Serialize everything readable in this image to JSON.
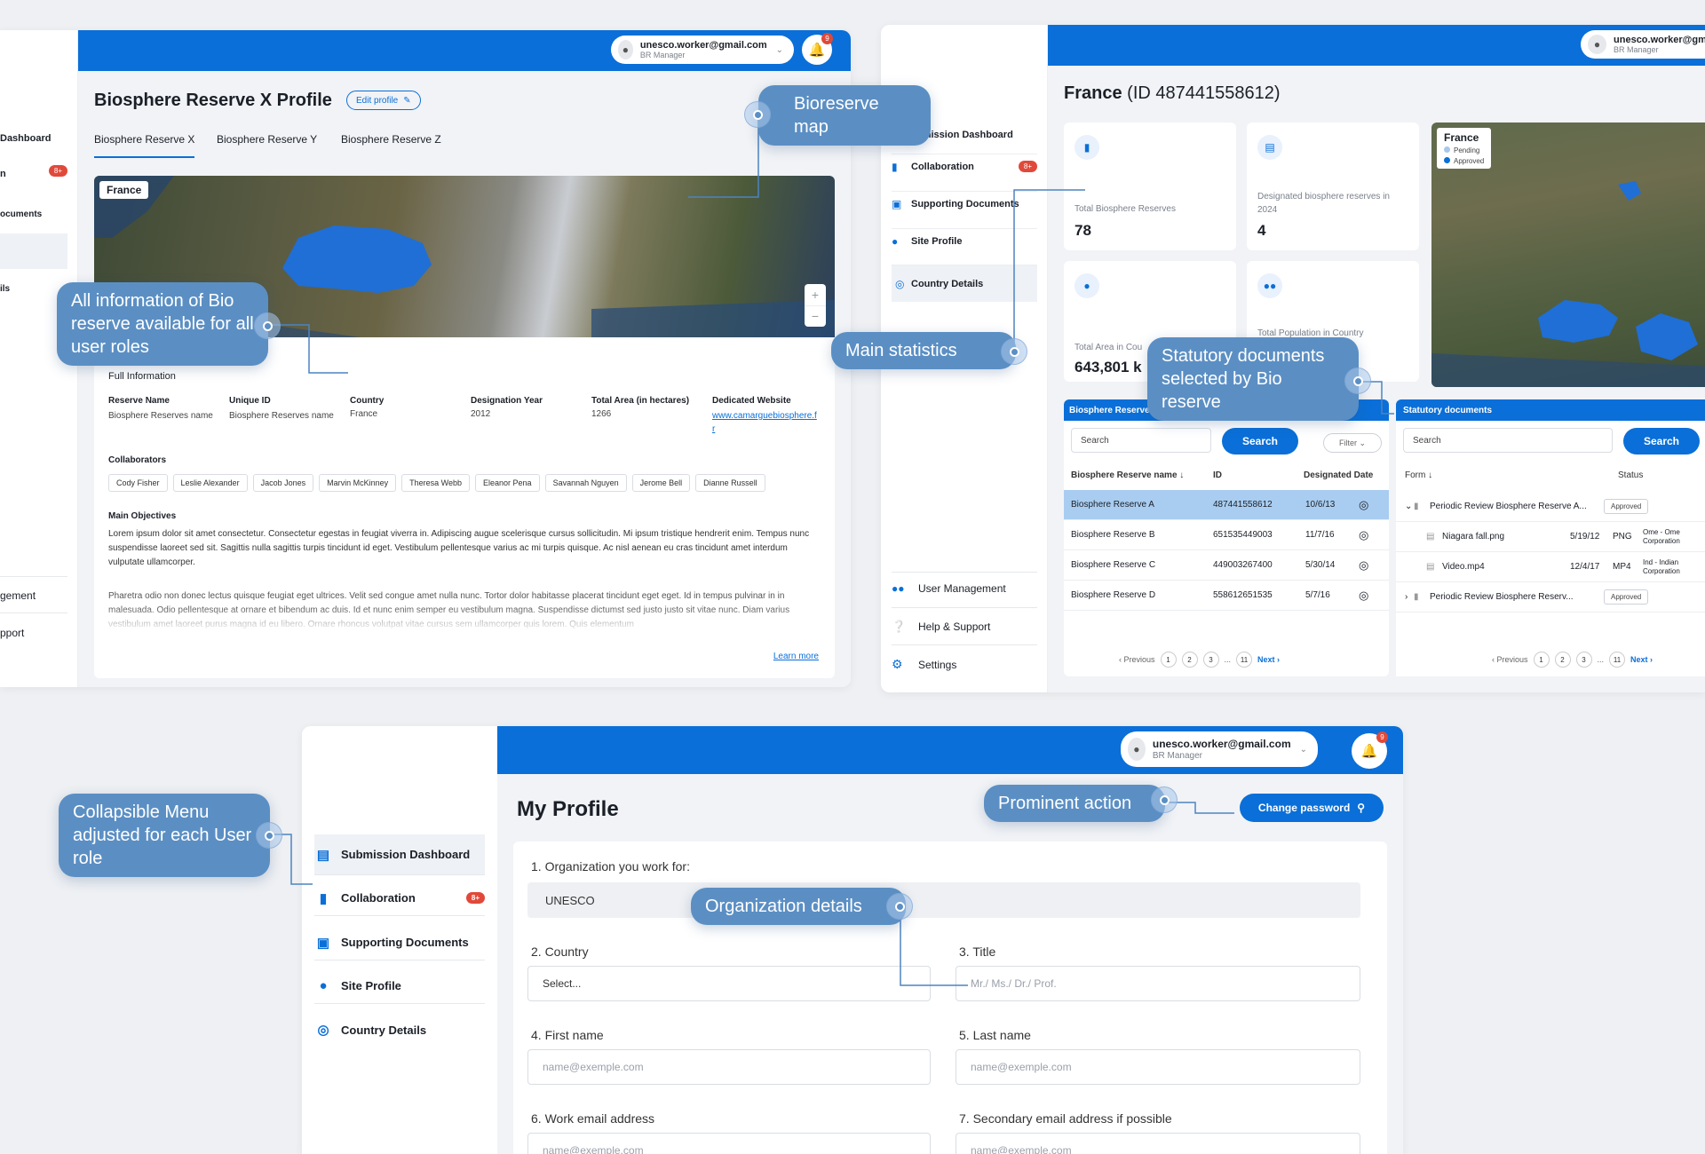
{
  "user": {
    "email": "unesco.worker@gmail.com",
    "email_trunc": "unesco.worker@gma",
    "role": "BR Manager",
    "notifications": "9"
  },
  "profile_panel": {
    "sidebar": {
      "dashboard": "Dashboard",
      "documents": "ocuments",
      "details": "ils",
      "badge": "8+",
      "management": "gement",
      "support": "pport"
    },
    "title": "Biosphere Reserve X Profile",
    "edit_button": "Edit profile",
    "tabs": [
      "Biosphere Reserve X",
      "Biosphere Reserve Y",
      "Biosphere Reserve Z"
    ],
    "map_label": "France",
    "section_title": "Full Information",
    "fields": [
      {
        "label": "Reserve Name",
        "value": "Biosphere Reserves name"
      },
      {
        "label": "Unique ID",
        "value": "Biosphere Reserves name"
      },
      {
        "label": "Country",
        "value": "France"
      },
      {
        "label": "Designation Year",
        "value": "2012"
      },
      {
        "label": "Total Area (in hectares)",
        "value": "1266"
      },
      {
        "label": "Dedicated Website",
        "value": "www.camarguebiosphere.fr"
      }
    ],
    "collaborators_title": "Collaborators",
    "collaborators": [
      "Cody Fisher",
      "Leslie Alexander",
      "Jacob Jones",
      "Marvin McKinney",
      "Theresa Webb",
      "Eleanor Pena",
      "Savannah Nguyen",
      "Jerome Bell",
      "Dianne Russell"
    ],
    "objectives_title": "Main Objectives",
    "objectives_p1": "Lorem ipsum dolor sit amet consectetur. Consectetur egestas in feugiat viverra in. Adipiscing augue scelerisque cursus sollicitudin. Mi ipsum tristique hendrerit enim. Tempus nunc suspendisse laoreet sed sit. Sagittis nulla sagittis turpis tincidunt id eget. Vestibulum pellentesque varius ac mi turpis quisque. Ac nisl aenean eu cras tincidunt amet interdum vulputate ullamcorper.",
    "objectives_p2": "Pharetra odio non donec lectus quisque feugiat eget ultrices. Velit sed congue amet nulla nunc. Tortor dolor habitasse placerat tincidunt eget eget. Id in tempus pulvinar in in malesuada. Odio pellentesque at ornare et bibendum ac duis. Id et nunc enim semper eu vestibulum magna. Suspendisse dictumst sed justo justo sit vitae nunc. Diam varius vestibulum amet laoreet purus magna id eu libero. Ornare rhoncus volutpat vitae cursus sem ullamcorper quis lorem. Quis elementum",
    "learn_more": "Learn more"
  },
  "country_panel": {
    "sidebar": [
      "omission Dashboard",
      "Collaboration",
      "Supporting Documents",
      "Site Profile",
      "Country Details",
      "User Management",
      "Help & Support",
      "Settings"
    ],
    "badge": "8+",
    "title": "France",
    "title_id": "(ID 487441558612)",
    "stats": [
      {
        "label": "Total Biosphere Reserves",
        "value": "78"
      },
      {
        "label": "Designated biosphere reserves in 2024",
        "value": "4"
      },
      {
        "label": "Total Area in Cou",
        "value": "643,801 k"
      },
      {
        "label": "Total Population in Country",
        "value": ""
      }
    ],
    "map_title": "France",
    "legend": [
      "Pending",
      "Approved"
    ],
    "reserves_header": "Biosphere Reserves",
    "search_placeholder": "Search",
    "search_button": "Search",
    "filter": "Filter",
    "columns": [
      "Biosphere Reserve name",
      "ID",
      "Designated Date"
    ],
    "rows": [
      {
        "name": "Biosphere Reserve A",
        "id": "487441558612",
        "date": "10/6/13"
      },
      {
        "name": "Biosphere Reserve B",
        "id": "651535449003",
        "date": "11/7/16"
      },
      {
        "name": "Biosphere Reserve C",
        "id": "449003267400",
        "date": "5/30/14"
      },
      {
        "name": "Biosphere Reserve D",
        "id": "558612651535",
        "date": "5/7/16"
      }
    ],
    "pager": {
      "prev": "Previous",
      "pages": [
        "1",
        "2",
        "3",
        "...",
        "11"
      ],
      "next": "Next"
    },
    "docs_header": "Statutory documents",
    "docs_columns": [
      "Form",
      "Status"
    ],
    "docs": [
      {
        "name": "Periodic Review Biosphere Reserve A...",
        "date": "",
        "type": "",
        "owner": "",
        "status": "Approved"
      },
      {
        "name": "Niagara fall.png",
        "date": "5/19/12",
        "type": "PNG",
        "owner": "Ome - Ome Corporation",
        "status": ""
      },
      {
        "name": "Video.mp4",
        "date": "12/4/17",
        "type": "MP4",
        "owner": "Ind - Indian Corporation",
        "status": ""
      },
      {
        "name": "Periodic Review Biosphere Reserv...",
        "date": "",
        "type": "",
        "owner": "",
        "status": "Approved"
      }
    ]
  },
  "my_profile_panel": {
    "menu": [
      "Submission Dashboard",
      "Collaboration",
      "Supporting Documents",
      "Site Profile",
      "Country Details"
    ],
    "badge": "8+",
    "title": "My Profile",
    "change_password": "Change password",
    "q1": "1. Organization you work for:",
    "q1_value": "UNESCO",
    "q2": "2. Country",
    "q2_value": "Select...",
    "q3": "3. Title",
    "q3_placeholder": "Mr./ Ms./ Dr./ Prof.",
    "q4": "4. First name",
    "q4_placeholder": "name@exemple.com",
    "q5": "5. Last name",
    "q5_placeholder": "name@exemple.com",
    "q6": "6. Work email address",
    "q6_placeholder": "name@exemple.com",
    "q7": "7. Secondary email address if possible",
    "q7_placeholder": "name@exemple.com"
  },
  "callouts": {
    "bioreserve_map": "Bioreserve map",
    "all_info": "All information of Bio reserve available for all user roles",
    "main_stats": "Main statistics",
    "statutory": "Statutory documents selected by Bio reserve",
    "collapsible": "Collapsible Menu adjusted for each User role",
    "prominent": "Prominent action",
    "org_details": "Organization details"
  },
  "colors": {
    "primary": "#0a6fd8",
    "callout": "#5b8fc4",
    "badge": "#e0493a",
    "water": "#1f6fd6"
  }
}
